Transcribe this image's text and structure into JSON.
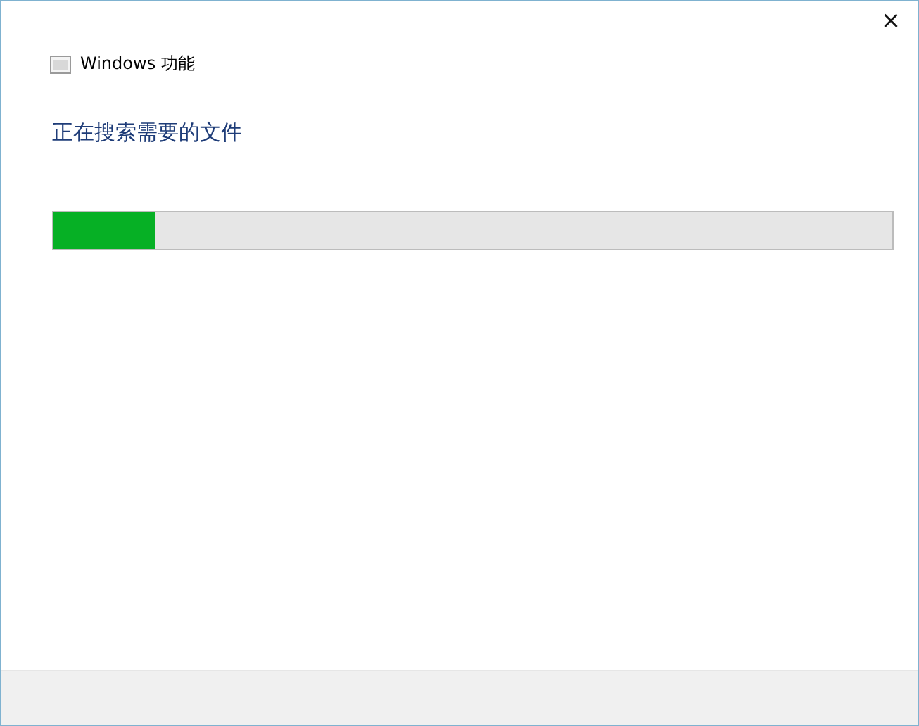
{
  "window": {
    "title": "Windows 功能",
    "close": "×"
  },
  "heading": "正在搜索需要的文件",
  "progress": {
    "level": 0.12
  }
}
